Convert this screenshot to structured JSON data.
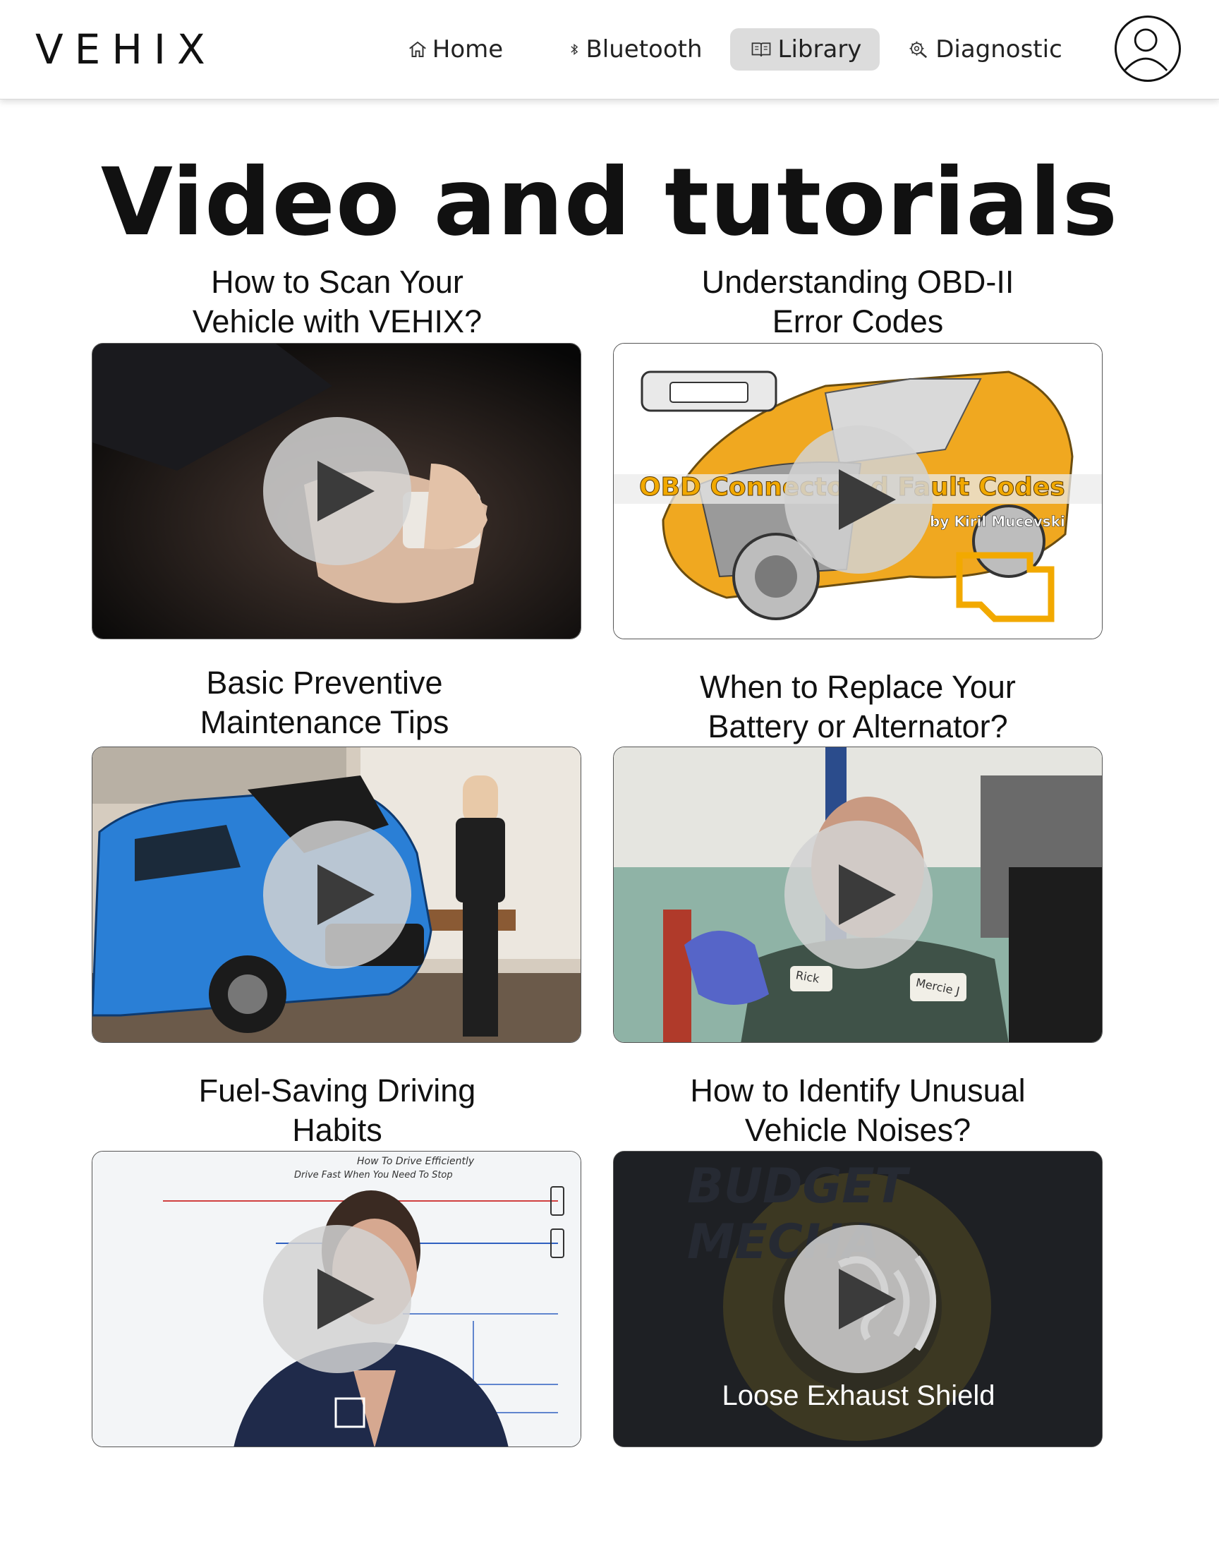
{
  "brand": {
    "logo": "VEHIX"
  },
  "nav": {
    "items": [
      {
        "label": "Home",
        "icon": "home-icon",
        "active": false
      },
      {
        "label": "Bluetooth",
        "icon": "bluetooth-icon",
        "active": false
      },
      {
        "label": "Library",
        "icon": "book-icon",
        "active": true
      },
      {
        "label": "Diagnostic",
        "icon": "engine-icon",
        "active": false
      }
    ],
    "active_bg": "#dcdcdc"
  },
  "user": {
    "icon": "user-avatar-icon"
  },
  "page": {
    "title": "Video and tutorials"
  },
  "videos": [
    {
      "title_line1": "How to Scan Your",
      "title_line2": "Vehicle with VEHIX?",
      "icon": "play-icon"
    },
    {
      "title_line1": "Understanding OBD-II",
      "title_line2": "Error Codes",
      "icon": "play-icon",
      "overlay_text": "OBD Connecto   d Fault Codes",
      "overlay_author": "by Kiril Mucevski",
      "accent": "#f2a900"
    },
    {
      "title_line1": "Basic Preventive",
      "title_line2": "Maintenance Tips",
      "icon": "play-icon"
    },
    {
      "title_line1": "When to Replace Your",
      "title_line2": "Battery or Alternator?",
      "icon": "play-icon",
      "badge1": "Rick",
      "badge2": "Mercie J"
    },
    {
      "title_line1": "Fuel-Saving Driving",
      "title_line2": "Habits",
      "icon": "play-icon",
      "whiteboard_title": "How To Drive Efficiently",
      "whiteboard_point": "Drive Fast When You Need To Stop"
    },
    {
      "title_line1": "How to Identify Unusual",
      "title_line2": "Vehicle Noises?",
      "icon": "play-icon",
      "caption": "Loose Exhaust Shield",
      "watermark": "BUDGET MECHA"
    }
  ]
}
